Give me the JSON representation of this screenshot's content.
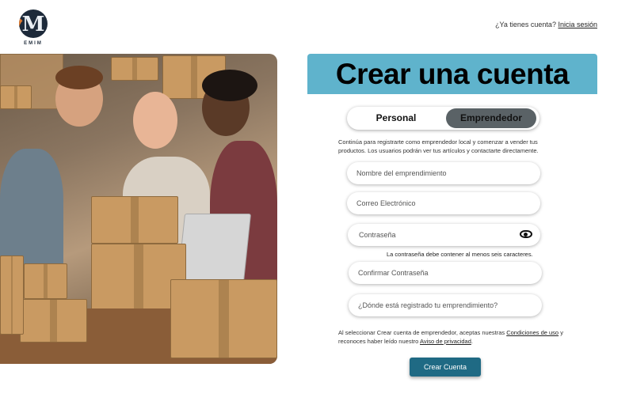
{
  "brand": {
    "logo_letter": "M",
    "name": "EMIM"
  },
  "header": {
    "prompt": "¿Ya tienes cuenta?",
    "login_link": "Inicia sesión"
  },
  "hero": {
    "image": "people-packing-boxes-photo"
  },
  "main": {
    "title": "Crear una cuenta",
    "toggle": {
      "options": [
        "Personal",
        "Emprendedor"
      ],
      "selected": "Emprendedor"
    },
    "description": "Continúa para registrarte como emprendedor local y comenzar a vender tus productos. Los usuarios podrán ver tus artículos y contactarte directamente.",
    "fields": {
      "business_name": {
        "placeholder": "Nombre del emprendimiento"
      },
      "email": {
        "placeholder": "Correo Electrónico"
      },
      "password": {
        "placeholder": "Contraseña",
        "icon": "eye-icon"
      },
      "password_hint": "La contraseña debe contener al menos seis caracteres.",
      "confirm_password": {
        "placeholder": "Confirmar Contraseña"
      },
      "registered_where": {
        "placeholder": "¿Dónde está registrado tu emprendimiento?"
      }
    },
    "terms": {
      "prefix": "Al seleccionar Crear cuenta de emprendedor, aceptas nuestras ",
      "conditions_link": "Condiciones de uso",
      "middle": " y reconoces haber leído nuestro ",
      "privacy_link": "Aviso de privacidad",
      "suffix": "."
    },
    "submit_label": "Crear Cuenta"
  },
  "colors": {
    "banner": "#5fb3cc",
    "button": "#1f6a84",
    "toggle_selected": "#5a6266"
  }
}
